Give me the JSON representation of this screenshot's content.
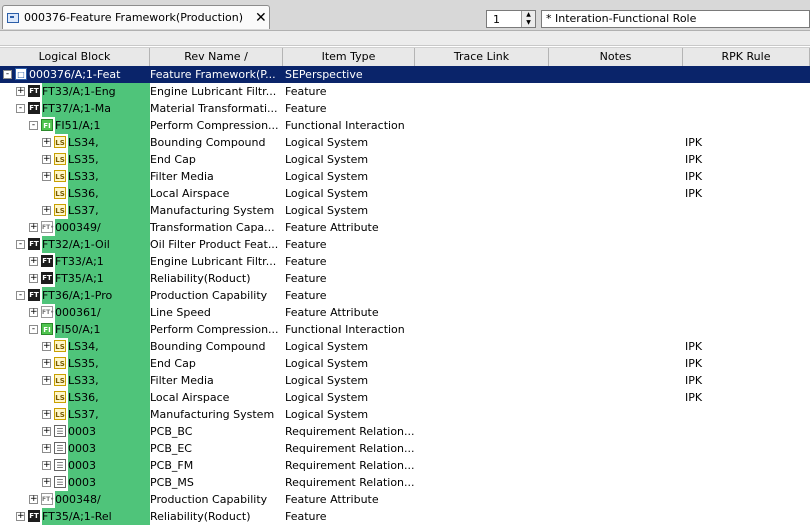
{
  "tab": {
    "title": "000376-Feature Framework(Production)",
    "close": "✕"
  },
  "toolbar": {
    "level_value": "1",
    "role_value": "* Interation-Functional Role"
  },
  "columns": [
    "Logical Block",
    "Rev Name  /",
    "Item Type",
    "Trace Link",
    "Notes",
    "RPK Rule"
  ],
  "rows": [
    {
      "level": 0,
      "exp": "-",
      "icon": "sep",
      "code": "000376/A;1-Feat",
      "rev": "Feature Framework(P...",
      "type": "SEPerspective",
      "rpk": "",
      "sel": true
    },
    {
      "level": 1,
      "exp": "+",
      "icon": "ft",
      "code": "FT33/A;1-Eng",
      "rev": "Engine Lubricant Filtr...",
      "type": "Feature",
      "rpk": ""
    },
    {
      "level": 1,
      "exp": "-",
      "icon": "ft",
      "code": "FT37/A;1-Ma",
      "rev": "Material Transformati...",
      "type": "Feature",
      "rpk": ""
    },
    {
      "level": 2,
      "exp": "-",
      "icon": "fi",
      "code": "FI51/A;1",
      "rev": "Perform Compression...",
      "type": "Functional Interaction",
      "rpk": ""
    },
    {
      "level": 3,
      "exp": "+",
      "icon": "ls",
      "code": "LS34,",
      "rev": "Bounding Compound",
      "type": "Logical System",
      "rpk": "IPK"
    },
    {
      "level": 3,
      "exp": "+",
      "icon": "ls",
      "code": "LS35,",
      "rev": "End Cap",
      "type": "Logical System",
      "rpk": "IPK"
    },
    {
      "level": 3,
      "exp": "+",
      "icon": "ls",
      "code": "LS33,",
      "rev": "Filter Media",
      "type": "Logical System",
      "rpk": "IPK"
    },
    {
      "level": 3,
      "exp": "",
      "icon": "ls",
      "code": "LS36,",
      "rev": "Local Airspace",
      "type": "Logical System",
      "rpk": "IPK"
    },
    {
      "level": 3,
      "exp": "+",
      "icon": "ls",
      "code": "LS37,",
      "rev": "Manufacturing System",
      "type": "Logical System",
      "rpk": ""
    },
    {
      "level": 2,
      "exp": "+",
      "icon": "fa",
      "code": "000349/",
      "rev": "Transformation Capa...",
      "type": "Feature Attribute",
      "rpk": ""
    },
    {
      "level": 1,
      "exp": "-",
      "icon": "ft",
      "code": "FT32/A;1-Oil",
      "rev": "Oil Filter Product Feat...",
      "type": "Feature",
      "rpk": ""
    },
    {
      "level": 2,
      "exp": "+",
      "icon": "ft",
      "code": "FT33/A;1",
      "rev": "Engine Lubricant Filtr...",
      "type": "Feature",
      "rpk": ""
    },
    {
      "level": 2,
      "exp": "+",
      "icon": "ft",
      "code": "FT35/A;1",
      "rev": "Reliability(Roduct)",
      "type": "Feature",
      "rpk": ""
    },
    {
      "level": 1,
      "exp": "-",
      "icon": "ft",
      "code": "FT36/A;1-Pro",
      "rev": "Production Capability",
      "type": "Feature",
      "rpk": ""
    },
    {
      "level": 2,
      "exp": "+",
      "icon": "fa",
      "code": "000361/",
      "rev": "Line Speed",
      "type": "Feature Attribute",
      "rpk": ""
    },
    {
      "level": 2,
      "exp": "-",
      "icon": "fi",
      "code": "FI50/A;1",
      "rev": "Perform Compression...",
      "type": "Functional Interaction",
      "rpk": ""
    },
    {
      "level": 3,
      "exp": "+",
      "icon": "ls",
      "code": "LS34,",
      "rev": "Bounding Compound",
      "type": "Logical System",
      "rpk": "IPK"
    },
    {
      "level": 3,
      "exp": "+",
      "icon": "ls",
      "code": "LS35,",
      "rev": "End Cap",
      "type": "Logical System",
      "rpk": "IPK"
    },
    {
      "level": 3,
      "exp": "+",
      "icon": "ls",
      "code": "LS33,",
      "rev": "Filter Media",
      "type": "Logical System",
      "rpk": "IPK"
    },
    {
      "level": 3,
      "exp": "",
      "icon": "ls",
      "code": "LS36,",
      "rev": "Local Airspace",
      "type": "Logical System",
      "rpk": "IPK"
    },
    {
      "level": 3,
      "exp": "+",
      "icon": "ls",
      "code": "LS37,",
      "rev": "Manufacturing System",
      "type": "Logical System",
      "rpk": ""
    },
    {
      "level": 3,
      "exp": "+",
      "icon": "doc",
      "code": "0003",
      "rev": "PCB_BC",
      "type": "Requirement Relation...",
      "rpk": ""
    },
    {
      "level": 3,
      "exp": "+",
      "icon": "doc",
      "code": "0003",
      "rev": "PCB_EC",
      "type": "Requirement Relation...",
      "rpk": ""
    },
    {
      "level": 3,
      "exp": "+",
      "icon": "doc",
      "code": "0003",
      "rev": "PCB_FM",
      "type": "Requirement Relation...",
      "rpk": ""
    },
    {
      "level": 3,
      "exp": "+",
      "icon": "doc",
      "code": "0003",
      "rev": "PCB_MS",
      "type": "Requirement Relation...",
      "rpk": ""
    },
    {
      "level": 2,
      "exp": "+",
      "icon": "fa",
      "code": "000348/",
      "rev": "Production Capability",
      "type": "Feature Attribute",
      "rpk": ""
    },
    {
      "level": 1,
      "exp": "+",
      "icon": "ft",
      "code": "FT35/A;1-Rel",
      "rev": "Reliability(Roduct)",
      "type": "Feature",
      "rpk": ""
    }
  ],
  "icon_glyphs": {
    "ft": "FT",
    "fi": "FI",
    "ls": "LS",
    "fa": "FT•",
    "doc": "☰",
    "sep": "□"
  },
  "colors": {
    "selection": "#0a246a",
    "highlight": "#4fc47a"
  }
}
